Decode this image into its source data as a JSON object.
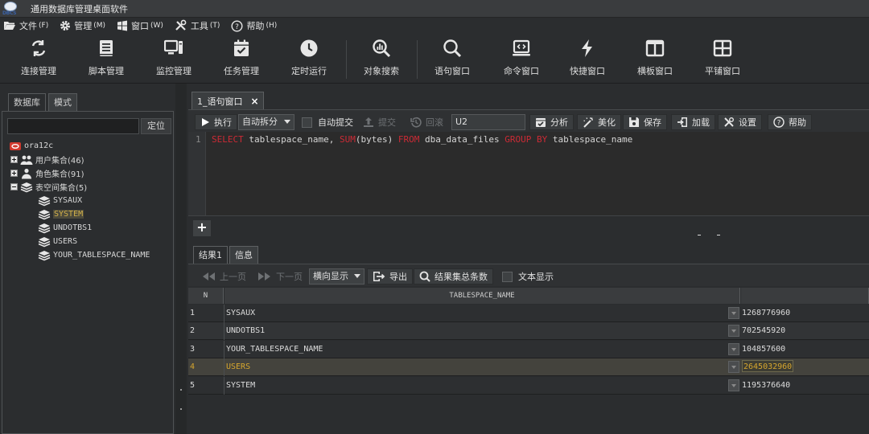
{
  "app": {
    "title": "通用数据库管理桌面软件"
  },
  "menu": [
    {
      "label": "文件",
      "key": "(F)",
      "icon": "folder-open-icon"
    },
    {
      "label": "管理",
      "key": "(M)",
      "icon": "gear-icon"
    },
    {
      "label": "窗口",
      "key": "(W)",
      "icon": "windows-icon"
    },
    {
      "label": "工具",
      "key": "(T)",
      "icon": "tools-icon"
    },
    {
      "label": "帮助",
      "key": "(H)",
      "icon": "help-circle-icon"
    }
  ],
  "toolbar": [
    {
      "label": "连接管理",
      "icon": "connection-icon"
    },
    {
      "label": "脚本管理",
      "icon": "script-icon"
    },
    {
      "label": "监控管理",
      "icon": "monitor-icon"
    },
    {
      "label": "任务管理",
      "icon": "calendar-check-icon"
    },
    {
      "label": "定时运行",
      "icon": "clock-icon"
    },
    {
      "label": "对象搜索",
      "icon": "object-search-icon"
    },
    {
      "label": "语句窗口",
      "icon": "search-icon"
    },
    {
      "label": "命令窗口",
      "icon": "command-window-icon"
    },
    {
      "label": "快捷窗口",
      "icon": "lightning-icon"
    },
    {
      "label": "横板窗口",
      "icon": "horizontal-window-icon"
    },
    {
      "label": "平铺窗口",
      "icon": "tile-window-icon"
    }
  ],
  "left_panel": {
    "tabs": [
      "数据库",
      "模式"
    ],
    "locate_label": "定位",
    "tree": {
      "root": "ora12c",
      "groups": [
        {
          "label": "用户集合(46)"
        },
        {
          "label": "角色集合(91)"
        },
        {
          "label": "表空间集合(5)"
        }
      ],
      "tablespaces": [
        "SYSAUX",
        "SYSTEM",
        "UNDOTBS1",
        "USERS",
        "YOUR_TABLESPACE_NAME"
      ]
    }
  },
  "editor": {
    "tab_label": "1_语句窗口",
    "toolbar": {
      "execute": "执行",
      "split_mode": "自动拆分",
      "auto_commit": "自动提交",
      "commit": "提交",
      "rollback": "回滚",
      "schema": "U2",
      "analyze": "分析",
      "beautify": "美化",
      "save": "保存",
      "load": "加载",
      "settings": "设置",
      "help": "帮助"
    },
    "line_number": "1",
    "sql": {
      "select": "SELECT",
      "p1": " tablespace_name, ",
      "sum": "SUM",
      "p2": "(bytes) ",
      "from": "FROM",
      "p3": " dba_data_files ",
      "group_by": "GROUP BY",
      "p4": " tablespace_name"
    }
  },
  "results": {
    "tabs": [
      "结果1",
      "信息"
    ],
    "toolbar": {
      "prev_page": "上一页",
      "next_page": "下一页",
      "display_mode": "横向显示",
      "export": "导出",
      "total_rows": "结果集总条数",
      "text_display": "文本显示"
    },
    "columns": [
      "N",
      "TABLESPACE_NAME"
    ],
    "rows": [
      {
        "n": "1",
        "name": "SYSAUX",
        "value": "1268776960"
      },
      {
        "n": "2",
        "name": "UNDOTBS1",
        "value": "702545920"
      },
      {
        "n": "3",
        "name": "YOUR_TABLESPACE_NAME",
        "value": "104857600"
      },
      {
        "n": "4",
        "name": "USERS",
        "value": "2645032960"
      },
      {
        "n": "5",
        "name": "SYSTEM",
        "value": "1195376640"
      }
    ],
    "selected_row": 4
  },
  "colors": {
    "keyword": "#cc2a35",
    "selected": "#d6a62e",
    "background": "#2b2d2f"
  }
}
